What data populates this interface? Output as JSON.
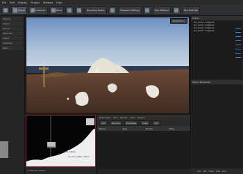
{
  "menu": [
    "File",
    "Edit",
    "Display",
    "Plugins",
    "Window",
    "Help"
  ],
  "toolbar": {
    "tools": [
      "Pointer",
      "Select",
      "Selection",
      "Move",
      "Rotate",
      "Scale",
      "Bounding Boxes",
      "Grid",
      "Viewport Settings",
      "Scene",
      "Snap",
      "Sim Settings",
      "Render",
      "Run Settings"
    ]
  },
  "left_panel": {
    "rows": [
      "Objects",
      "Layers",
      "Groups",
      "Materials",
      "Lights",
      "Cameras",
      "Sets"
    ]
  },
  "viewport": {
    "camera_label": "Perspective"
  },
  "scene_tree": {
    "header": "Scene",
    "items": [
      "Ibo_Kokot 4 Objects",
      "Ibo_Kokot 2 Objects",
      "Ibo_Kokot 3 Objects",
      "Ibo_Kokot 1 Objects"
    ]
  },
  "properties": {
    "header": "Object Properties"
  },
  "preview": {
    "labels": [
      "Ice_Rock_1_Mesh",
      "Ice_Rock_2_Mesh",
      "ice_rock_2_Mesh_collision"
    ],
    "info": "1 Selected Object"
  },
  "bottom_panel": {
    "tabs": [
      "Scene Tree",
      "Sim",
      "Render",
      "Grid",
      "Output",
      "Log",
      "Log"
    ],
    "buttons": [
      "Add",
      "Remove",
      "Duplicate",
      "Clear",
      "Sim",
      "Render"
    ],
    "columns": [
      "Name",
      "Type",
      "Bodies",
      "Mass"
    ]
  },
  "status": [
    "Sim",
    "Ref",
    "Filter",
    "Stat",
    "Run"
  ],
  "colors": {
    "accent": "#3f7fd0",
    "preview_border": "#8a2030"
  }
}
